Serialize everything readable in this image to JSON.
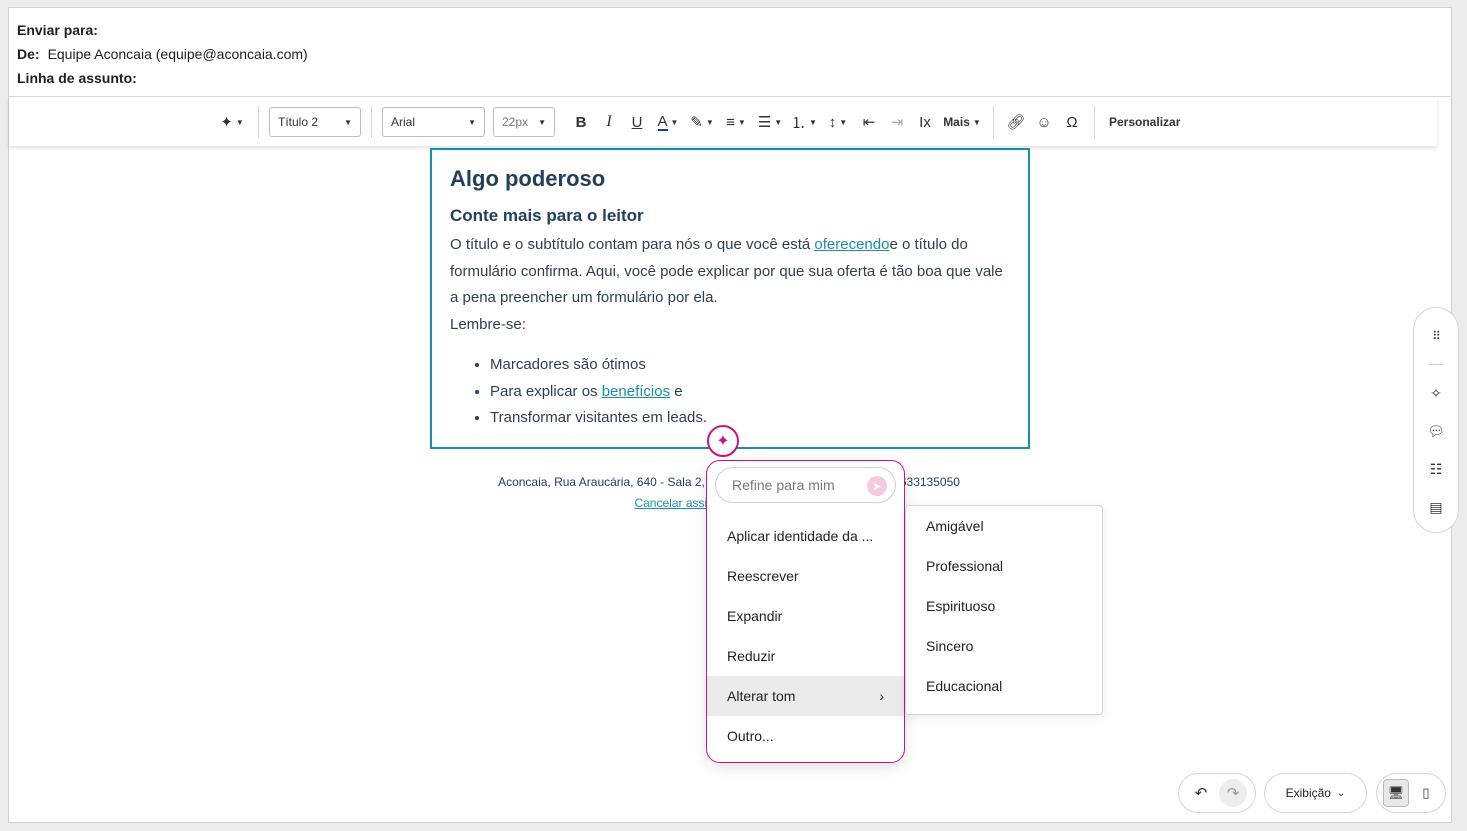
{
  "header": {
    "to_label": "Enviar para:",
    "from_label": "De:",
    "from_value": "Equipe Aconcaia (equipe@aconcaia.com)",
    "subject_label": "Linha de assunto:"
  },
  "toolbar": {
    "style_select": "Título 2",
    "font_select": "Arial",
    "size_select": "22px",
    "more_label": "Mais",
    "personalize_label": "Personalizar"
  },
  "content": {
    "heading": "Algo poderoso",
    "subheading": "Conte mais para o leitor",
    "para_part1": "O título e o subtítulo contam para nós o que você está ",
    "para_link": "oferecendo",
    "para_part2": "e o título do formulário confirma. Aqui, você pode explicar por que sua oferta é tão boa que vale a pena preencher um formulário por ela.",
    "remember": "Lembre-se:",
    "bullets": {
      "b1": "Marcadores são ótimos",
      "b2_pre": "Para explicar os ",
      "b2_link": "benefícios",
      "b2_post": " e",
      "b3": "Transformar visitantes em leads."
    }
  },
  "footer": {
    "address_left": "Aconcaia, Rua Araucária, 640 - Sala 2,",
    "address_right": "633135050",
    "unsubscribe": "Cancelar assinatu"
  },
  "ai_menu": {
    "placeholder": "Refine para mim",
    "items": [
      "Aplicar identidade da ...",
      "Reescrever",
      "Expandir",
      "Reduzir",
      "Alterar tom",
      "Outro..."
    ]
  },
  "tone_menu": {
    "items": [
      "Amigável",
      "Professional",
      "Espirituoso",
      "Sincero",
      "Educacional"
    ]
  },
  "bottom": {
    "view_label": "Exibição"
  }
}
